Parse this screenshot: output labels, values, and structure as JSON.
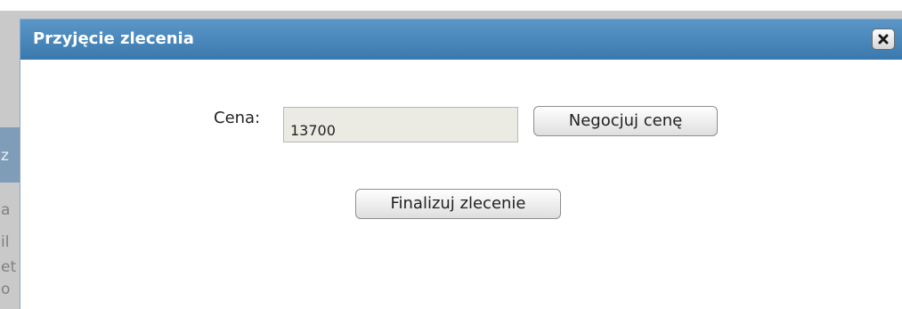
{
  "dialog": {
    "title": "Przyjęcie zlecenia",
    "close_icon": "close-icon"
  },
  "form": {
    "price_label": "Cena:",
    "price_value": "13700",
    "negotiate_label": "Negocjuj cenę",
    "finalize_label": "Finalizuj zlecenie"
  },
  "backdrop": {
    "fragments": [
      "z",
      "a",
      "il",
      "et",
      "o"
    ]
  },
  "colors": {
    "titlebar": "#4a88bd",
    "title_text": "#ffffff",
    "input_bg": "#ebebe4"
  }
}
